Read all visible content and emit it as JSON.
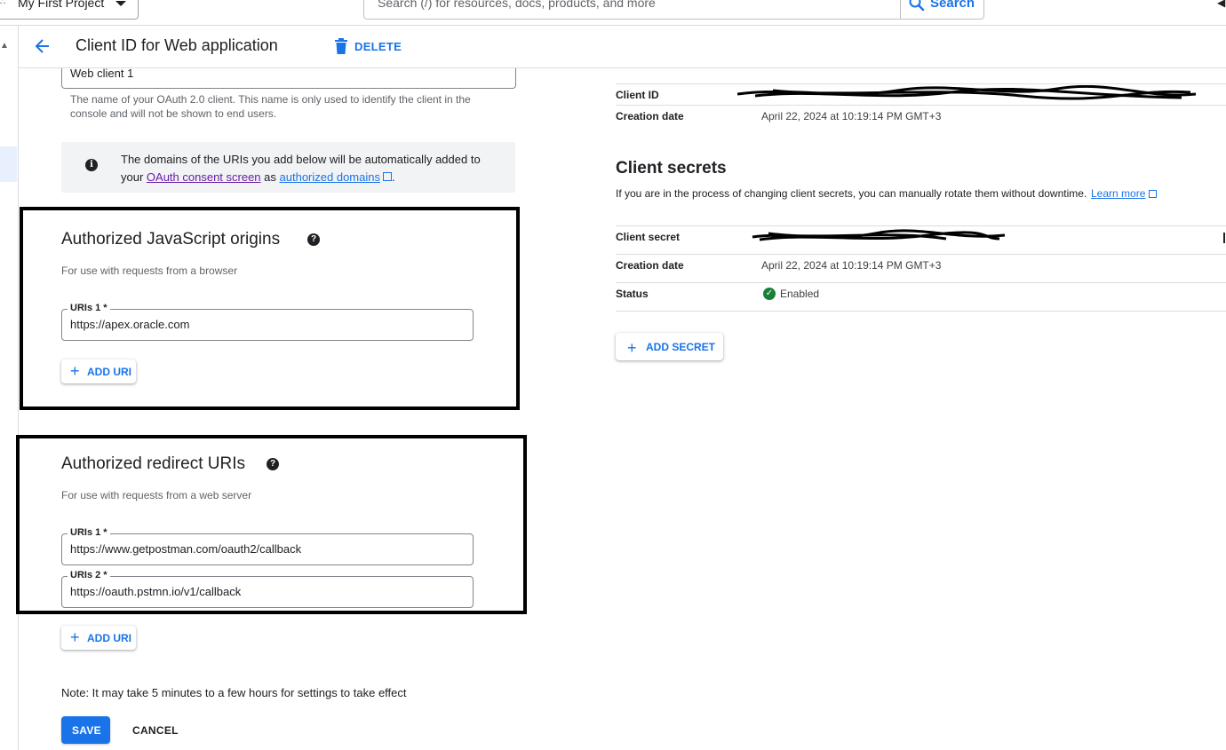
{
  "topbar": {
    "project_name": "My First Project",
    "search_placeholder": "Search (/) for resources, docs, products, and more",
    "search_button": "Search"
  },
  "header": {
    "title": "Client ID for Web application",
    "delete_label": "DELETE"
  },
  "name_field": {
    "value": "Web client 1",
    "hint": "The name of your OAuth 2.0 client. This name is only used to identify the client in the console and will not be shown to end users."
  },
  "info": {
    "text_before": "The domains of the URIs you add below will be automatically added to your ",
    "link1": "OAuth consent screen",
    "text_middle": " as ",
    "link2": "authorized domains",
    "text_after": "."
  },
  "js_origins": {
    "title": "Authorized JavaScript origins",
    "subtitle": "For use with requests from a browser",
    "uris": [
      {
        "label": "URIs 1 *",
        "value": "https://apex.oracle.com"
      }
    ],
    "add_label": "ADD URI"
  },
  "redirect_uris": {
    "title": "Authorized redirect URIs",
    "subtitle": "For use with requests from a web server",
    "uris": [
      {
        "label": "URIs 1 *",
        "value": "https://www.getpostman.com/oauth2/callback"
      },
      {
        "label": "URIs 2 *",
        "value": "https://oauth.pstmn.io/v1/callback"
      }
    ],
    "add_label": "ADD URI"
  },
  "footer": {
    "note": "Note: It may take 5 minutes to a few hours for settings to take effect",
    "save": "SAVE",
    "cancel": "CANCEL"
  },
  "client_info": {
    "client_id_label": "Client ID",
    "creation_date_label": "Creation date",
    "creation_date": "April 22, 2024 at 10:19:14 PM GMT+3"
  },
  "secrets": {
    "title": "Client secrets",
    "description": "If you are in the process of changing client secrets, you can manually rotate them without downtime.",
    "learn_more": "Learn more",
    "secret_label": "Client secret",
    "creation_date_label": "Creation date",
    "creation_date": "April 22, 2024 at 10:19:14 PM GMT+3",
    "status_label": "Status",
    "status": "Enabled",
    "add_label": "ADD SECRET"
  },
  "colors": {
    "accent": "#1a73e8",
    "status_enabled": "#188038",
    "visited_link": "#681da8"
  },
  "icons": [
    "project-icon",
    "caret-down-icon",
    "search-icon",
    "back-arrow-icon",
    "trash-icon",
    "info-icon",
    "help-icon",
    "plus-icon",
    "external-link-icon",
    "check-circle-icon"
  ]
}
